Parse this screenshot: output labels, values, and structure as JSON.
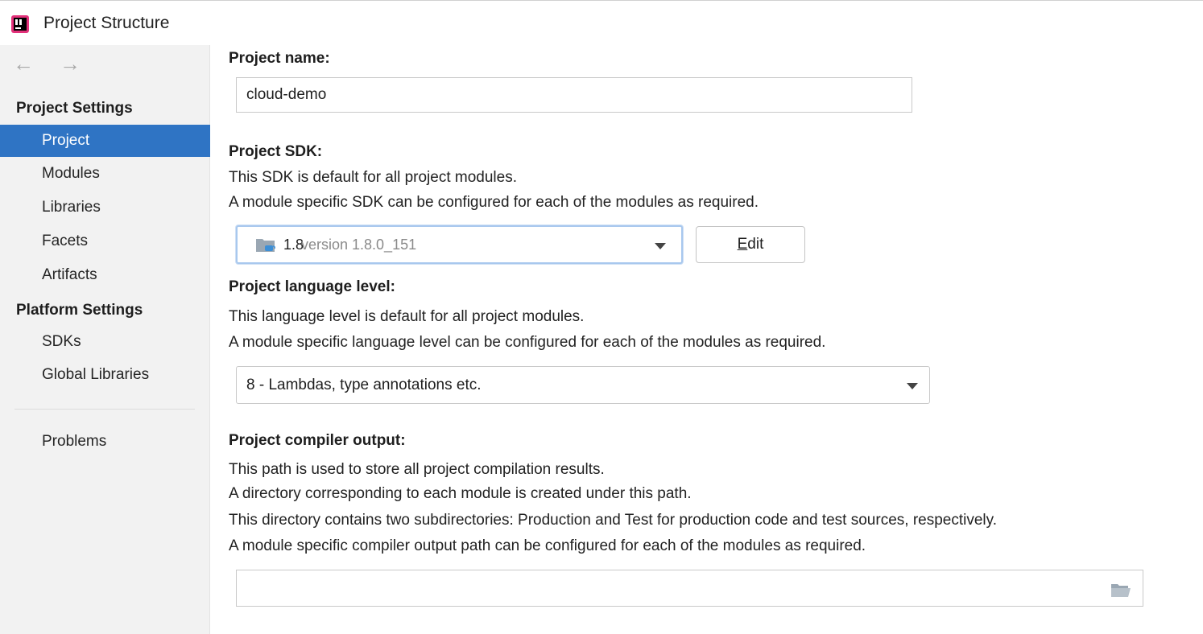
{
  "window": {
    "title": "Project Structure",
    "app_icon": "intellij-idea-icon"
  },
  "sidebar": {
    "back_icon": "arrow-left-icon",
    "forward_icon": "arrow-right-icon",
    "back_glyph": "←",
    "forward_glyph": "→",
    "project_settings_heading": "Project Settings",
    "project_items": [
      "Project",
      "Modules",
      "Libraries",
      "Facets",
      "Artifacts"
    ],
    "platform_settings_heading": "Platform Settings",
    "platform_items": [
      "SDKs",
      "Global Libraries"
    ],
    "problems_label": "Problems",
    "selected_item": "Project"
  },
  "main": {
    "project_name": {
      "heading": "Project name:",
      "value": "cloud-demo"
    },
    "project_sdk": {
      "heading": "Project SDK:",
      "desc_line1": "This SDK is default for all project modules.",
      "desc_line2": "A module specific SDK can be configured for each of the modules as required.",
      "selected_sdk_name": "1.8",
      "selected_sdk_version": "version 1.8.0_151",
      "edit_button_mnemonic": "E",
      "edit_button_rest": "dit"
    },
    "language_level": {
      "heading": "Project language level:",
      "desc_line1": "This language level is default for all project modules.",
      "desc_line2": "A module specific language level can be configured for each of the modules as required.",
      "selected": "8 - Lambdas, type annotations etc."
    },
    "compiler_output": {
      "heading": "Project compiler output:",
      "desc_line1": "This path is used to store all project compilation results.",
      "desc_line2": "A directory corresponding to each module is created under this path.",
      "desc_line3": "This directory contains two subdirectories: Production and Test for production code and test sources, respectively.",
      "desc_line4": "A module specific compiler output path can be configured for each of the modules as required.",
      "value": "",
      "browse_icon": "folder-open-icon"
    }
  },
  "colors": {
    "selection": "#2f74c4",
    "sidebar_bg": "#f2f2f2",
    "focus_ring": "#a8c8ee"
  }
}
